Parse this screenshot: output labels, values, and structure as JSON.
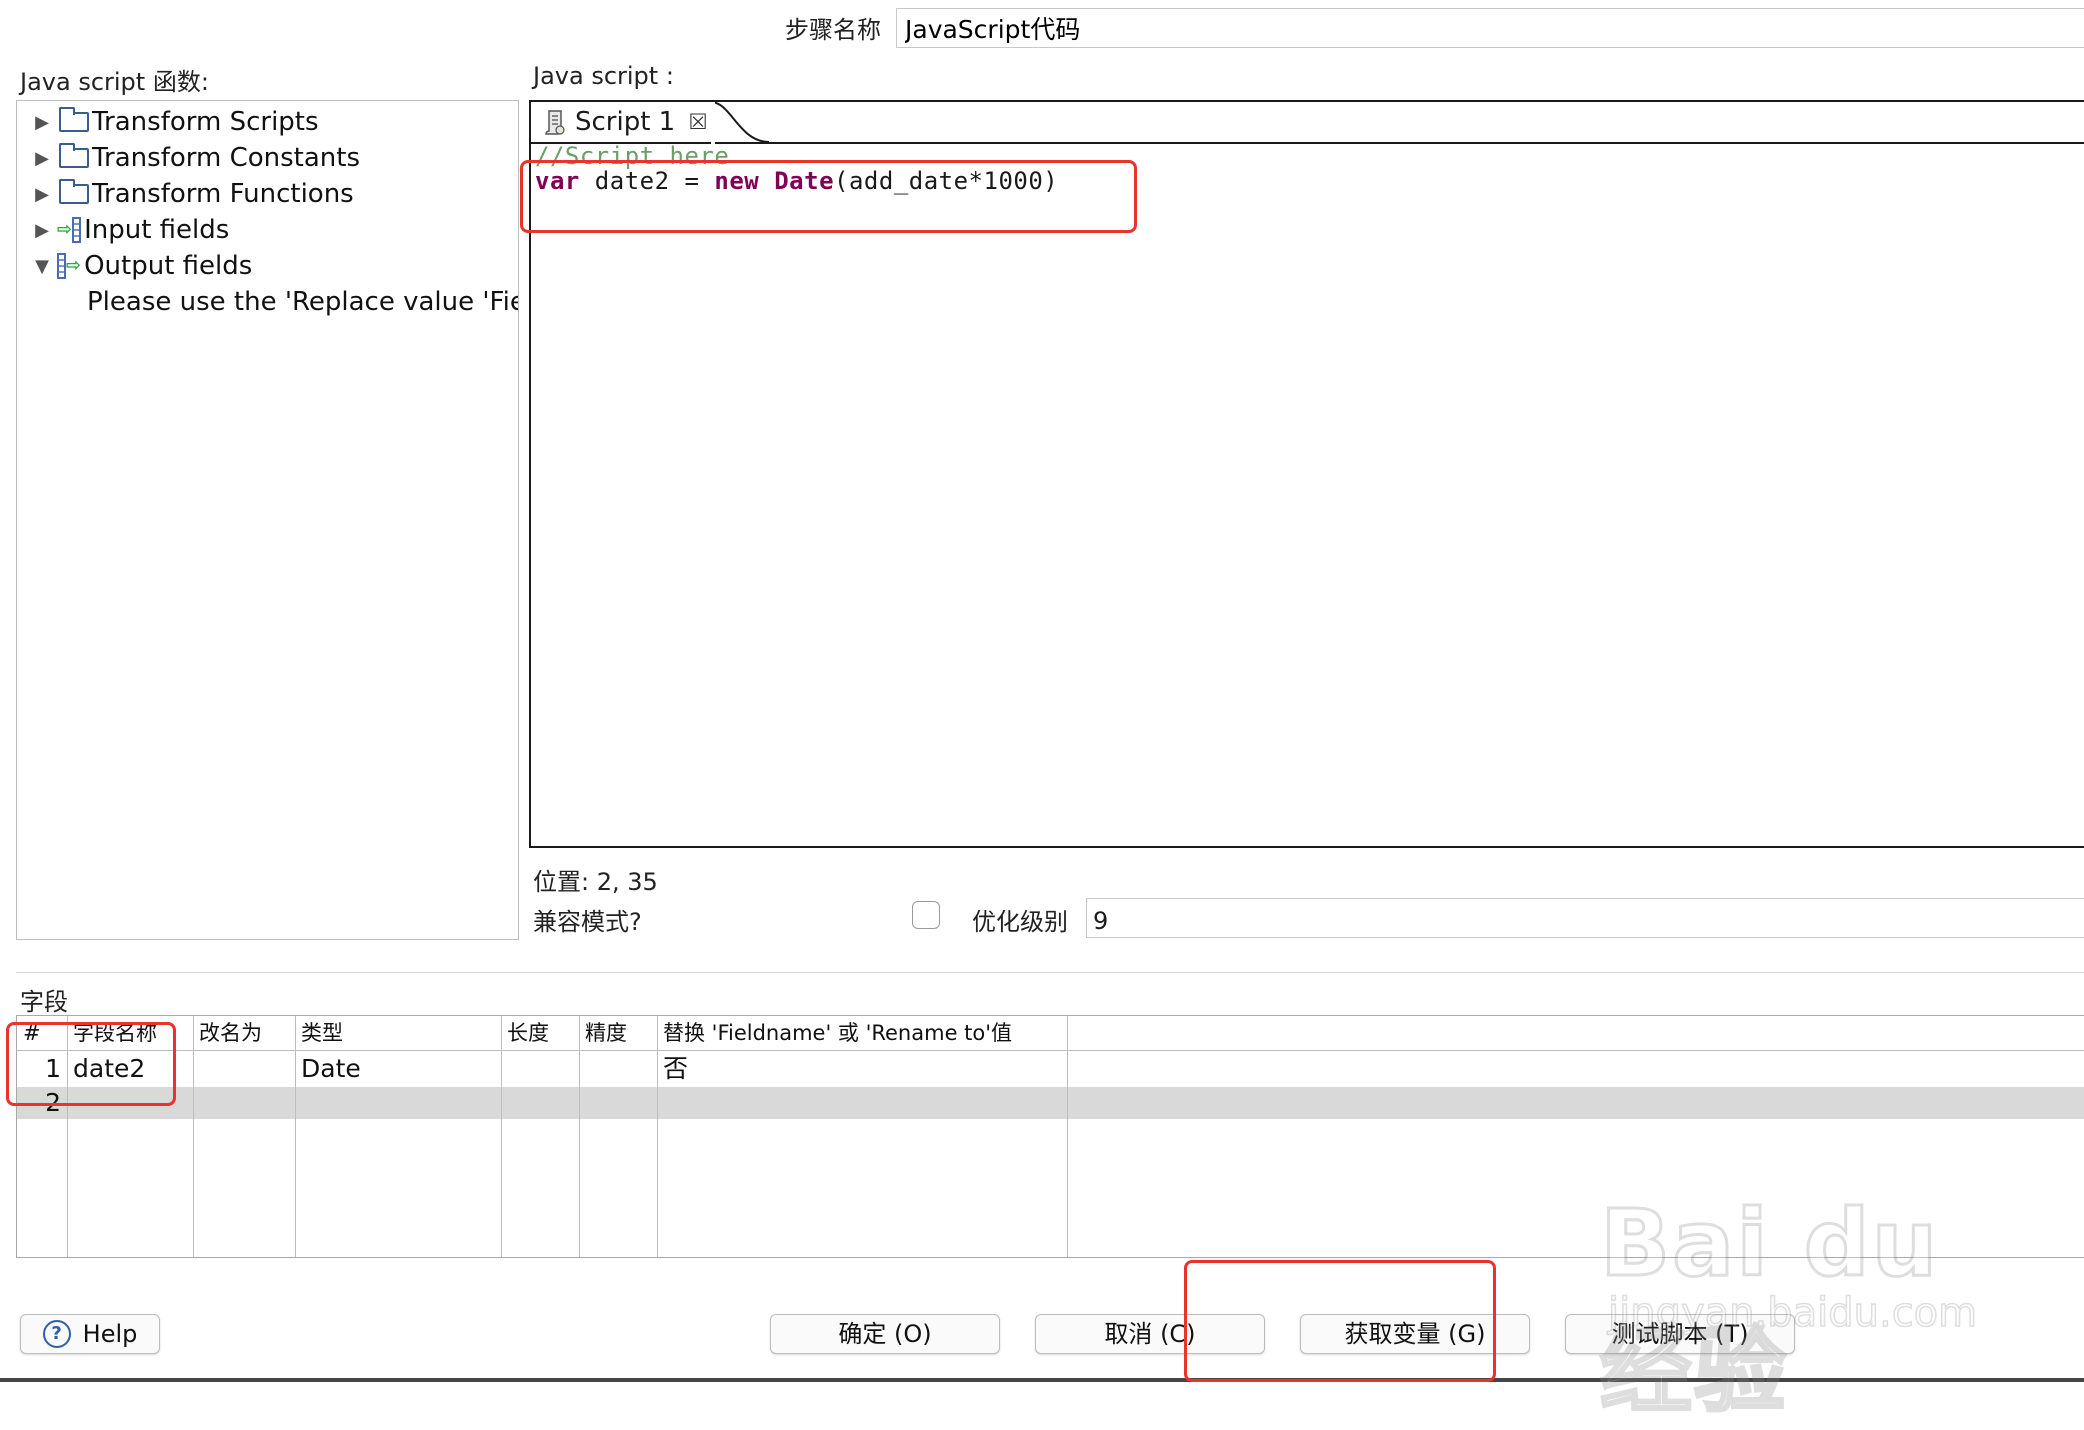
{
  "step": {
    "label": "步骤名称",
    "value": "JavaScript代码"
  },
  "functions": {
    "label": "Java script 函数:",
    "tree": [
      {
        "label": "Transform Scripts",
        "icon": "folder-icon",
        "expanded": false
      },
      {
        "label": "Transform Constants",
        "icon": "folder-icon",
        "expanded": false
      },
      {
        "label": "Transform Functions",
        "icon": "folder-icon",
        "expanded": false
      },
      {
        "label": "Input fields",
        "icon": "input-fields-icon",
        "expanded": false
      },
      {
        "label": "Output fields",
        "icon": "output-fields-icon",
        "expanded": true
      }
    ],
    "output_hint": "Please use the 'Replace value 'Fieldname' or 'Rename to' ' option"
  },
  "script": {
    "label": "Java script :",
    "tab_label": "Script 1",
    "comment_line": "//Script here",
    "code": {
      "kw_var": "var",
      "part1": " date2 = ",
      "kw_new": "new",
      "kw_date": "Date",
      "part2": "(add_date*1000)"
    },
    "position": "位置: 2, 35",
    "compat_label": "兼容模式?",
    "compat_checked": false,
    "opt_label": "优化级别",
    "opt_value": "9"
  },
  "fields": {
    "section_label": "字段",
    "columns": [
      "#",
      "字段名称",
      "改名为",
      "类型",
      "长度",
      "精度",
      "替换 'Fieldname' 或 'Rename to'值"
    ],
    "rows": [
      {
        "num": "1",
        "name": "date2",
        "rename": "",
        "type": "Date",
        "length": "",
        "precision": "",
        "replace": "否"
      },
      {
        "num": "2",
        "name": "",
        "rename": "",
        "type": "",
        "length": "",
        "precision": "",
        "replace": ""
      }
    ]
  },
  "buttons": {
    "help": "Help",
    "ok": "确定 (O)",
    "cancel": "取消 (C)",
    "get_vars": "获取变量 (G)",
    "test": "测试脚本 (T)"
  },
  "watermark": {
    "main": "Bai du 经验",
    "sub": "jingyan.baidu.com"
  },
  "colors": {
    "annotation_red": "#e8342c",
    "keyword": "#7f0055",
    "comment": "#6a9f6a",
    "selected_row": "#d9d9d9"
  }
}
